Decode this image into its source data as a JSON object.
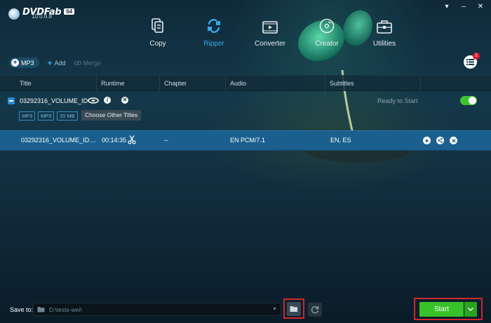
{
  "app": {
    "brand": "DVDFab",
    "badge": "64",
    "version": "10.0.6.8"
  },
  "tabs": [
    {
      "label": "Copy",
      "icon": "copy-icon"
    },
    {
      "label": "Ripper",
      "icon": "ripper-icon",
      "active": true
    },
    {
      "label": "Converter",
      "icon": "converter-icon"
    },
    {
      "label": "Creator",
      "icon": "creator-icon"
    },
    {
      "label": "Utilities",
      "icon": "utilities-icon"
    }
  ],
  "toolbar": {
    "mode": "MP3",
    "add": "Add",
    "merge": "Merge",
    "queue_count": "1"
  },
  "columns": [
    "Title",
    "Runtime",
    "Chapter",
    "Audio",
    "Subtitles"
  ],
  "source": {
    "name": "03292316_VOLUME_ID",
    "tags": [
      "MP3",
      "MP3",
      "20 MB"
    ],
    "choose_label": "Choose Other Titles",
    "status": "Ready to Start"
  },
  "title_row": {
    "title": "03292316_VOLUME_ID....",
    "runtime": "00:14:35",
    "chapter": "--",
    "audio": "EN  PCM/7.1",
    "subtitles": "EN, ES"
  },
  "bottom": {
    "save_label": "Save to:",
    "save_path": "D:\\tests-wei\\",
    "start_label": "Start"
  },
  "colors": {
    "accent": "#36a9e8",
    "start_green": "#37c229",
    "highlight_red": "#d0282e",
    "row_blue": "#1a5f8e"
  }
}
